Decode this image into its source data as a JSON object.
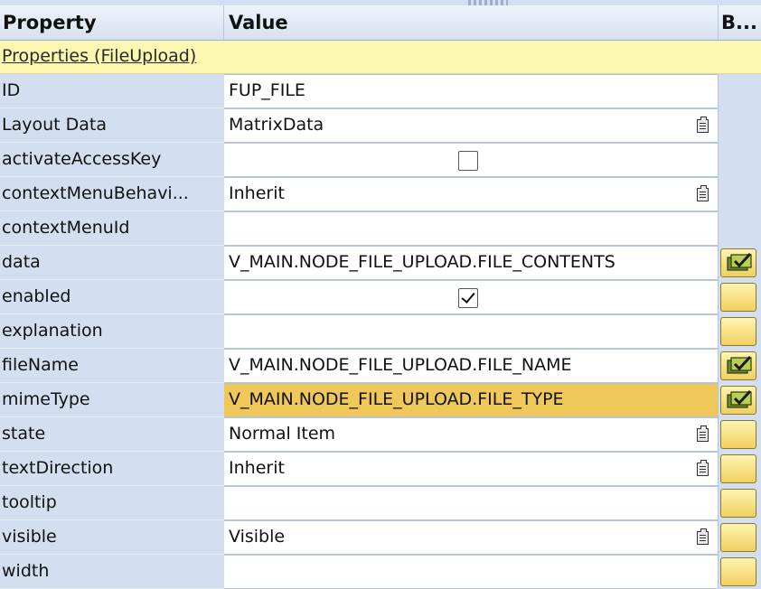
{
  "header": {
    "property": "Property",
    "value": "Value",
    "binding": "B..."
  },
  "group": {
    "label": "Properties (FileUpload)"
  },
  "rows": [
    {
      "name": "ID",
      "value": "FUP_FILE",
      "control": "text",
      "binding": "none"
    },
    {
      "name": "Layout Data",
      "value": "MatrixData",
      "control": "dropdown",
      "binding": "none"
    },
    {
      "name": "activateAccessKey",
      "value": "",
      "control": "checkbox",
      "checked": false,
      "binding": "none"
    },
    {
      "name": "contextMenuBehavi...",
      "value": "Inherit",
      "control": "dropdown",
      "binding": "none"
    },
    {
      "name": "contextMenuId",
      "value": "",
      "control": "text",
      "binding": "none"
    },
    {
      "name": "data",
      "value": "V_MAIN.NODE_FILE_UPLOAD.FILE_CONTENTS",
      "control": "text",
      "binding": "bound"
    },
    {
      "name": "enabled",
      "value": "",
      "control": "checkbox",
      "checked": true,
      "binding": "empty"
    },
    {
      "name": "explanation",
      "value": "",
      "control": "text",
      "binding": "empty"
    },
    {
      "name": "fileName",
      "value": "V_MAIN.NODE_FILE_UPLOAD.FILE_NAME",
      "control": "text",
      "binding": "bound"
    },
    {
      "name": "mimeType",
      "value": "V_MAIN.NODE_FILE_UPLOAD.FILE_TYPE",
      "control": "text",
      "binding": "bound",
      "selected": true
    },
    {
      "name": "state",
      "value": "Normal Item",
      "control": "dropdown",
      "binding": "empty"
    },
    {
      "name": "textDirection",
      "value": "Inherit",
      "control": "dropdown",
      "binding": "empty"
    },
    {
      "name": "tooltip",
      "value": "",
      "control": "text",
      "binding": "empty"
    },
    {
      "name": "visible",
      "value": "Visible",
      "control": "dropdown",
      "binding": "empty"
    },
    {
      "name": "width",
      "value": "",
      "control": "text",
      "binding": "empty"
    }
  ],
  "colors": {
    "property_bg": "#d3dff0",
    "group_bg": "#fbf6b0",
    "selected_bg": "#f0c85a",
    "binding_button": "#f0d060"
  }
}
